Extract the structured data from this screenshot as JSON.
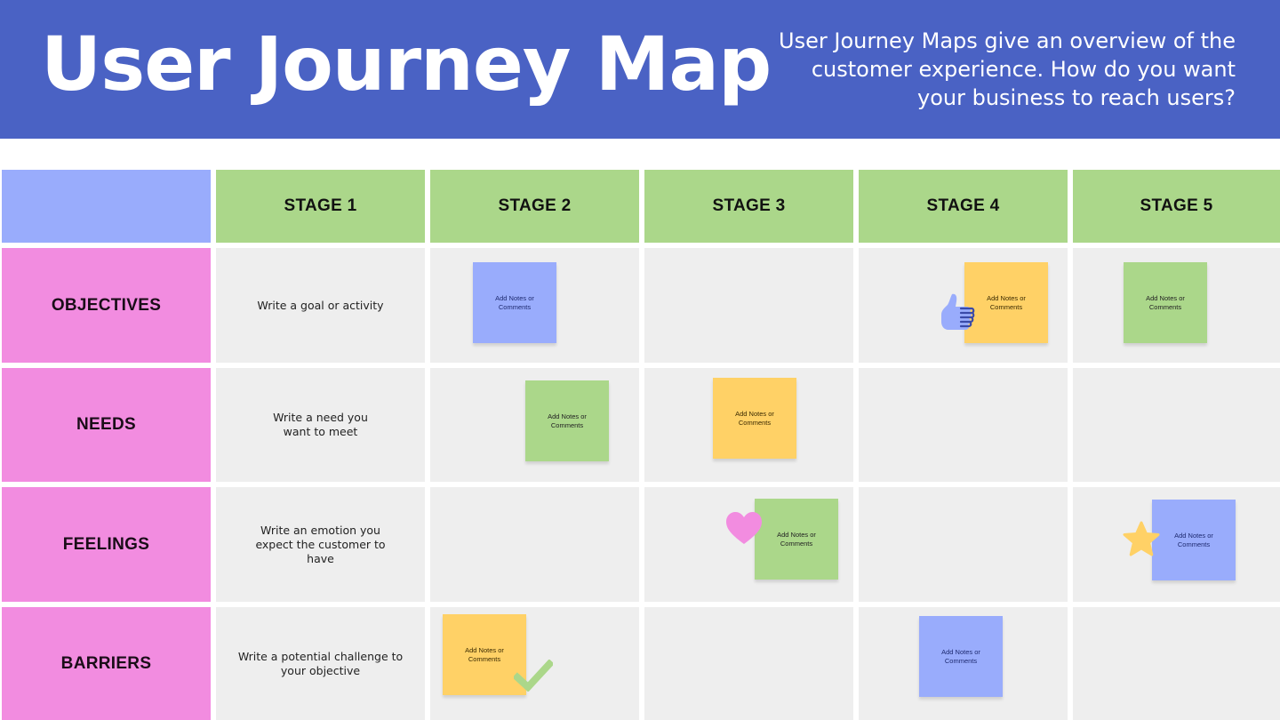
{
  "banner": {
    "title": "User Journey Map",
    "description": "User Journey Maps give an overview of the customer experience. How do you want your business to reach users?",
    "background_color": "#4a62c4"
  },
  "colors": {
    "corner": "#99acfc",
    "stage_header": "#abd78a",
    "row_header": "#f28ce0",
    "cell": "#eeeeee",
    "note_blue": "#99acfc",
    "note_green": "#abd78a",
    "note_yellow": "#ffd166"
  },
  "stages": [
    {
      "label": "STAGE 1"
    },
    {
      "label": "STAGE 2"
    },
    {
      "label": "STAGE 3"
    },
    {
      "label": "STAGE 4"
    },
    {
      "label": "STAGE 5"
    }
  ],
  "rows": [
    {
      "label": "OBJECTIVES",
      "prompt": "Write a goal or activity"
    },
    {
      "label": "NEEDS",
      "prompt": "Write a need you want to meet"
    },
    {
      "label": "FEELINGS",
      "prompt": "Write an emotion you expect the customer to have"
    },
    {
      "label": "BARRIERS",
      "prompt": "Write a potential challenge to your objective"
    }
  ],
  "notes": [
    {
      "row": "OBJECTIVES",
      "stage": "STAGE 2",
      "color": "blue",
      "text": "Add Notes or Comments"
    },
    {
      "row": "OBJECTIVES",
      "stage": "STAGE 4",
      "color": "yellow",
      "text": "Add Notes or Comments",
      "sticker": "thumbs-up"
    },
    {
      "row": "OBJECTIVES",
      "stage": "STAGE 5",
      "color": "green",
      "text": "Add Notes or Comments"
    },
    {
      "row": "NEEDS",
      "stage": "STAGE 2",
      "color": "green",
      "text": "Add Notes or Comments"
    },
    {
      "row": "NEEDS",
      "stage": "STAGE 3",
      "color": "yellow",
      "text": "Add Notes or Comments"
    },
    {
      "row": "FEELINGS",
      "stage": "STAGE 3",
      "color": "green",
      "text": "Add Notes or Comments",
      "sticker": "heart"
    },
    {
      "row": "FEELINGS",
      "stage": "STAGE 5",
      "color": "blue",
      "text": "Add Notes or Comments",
      "sticker": "star"
    },
    {
      "row": "BARRIERS",
      "stage": "STAGE 2",
      "color": "yellow",
      "text": "Add Notes or Comments",
      "sticker": "checkmark"
    },
    {
      "row": "BARRIERS",
      "stage": "STAGE 4",
      "color": "blue",
      "text": "Add Notes or Comments"
    }
  ]
}
